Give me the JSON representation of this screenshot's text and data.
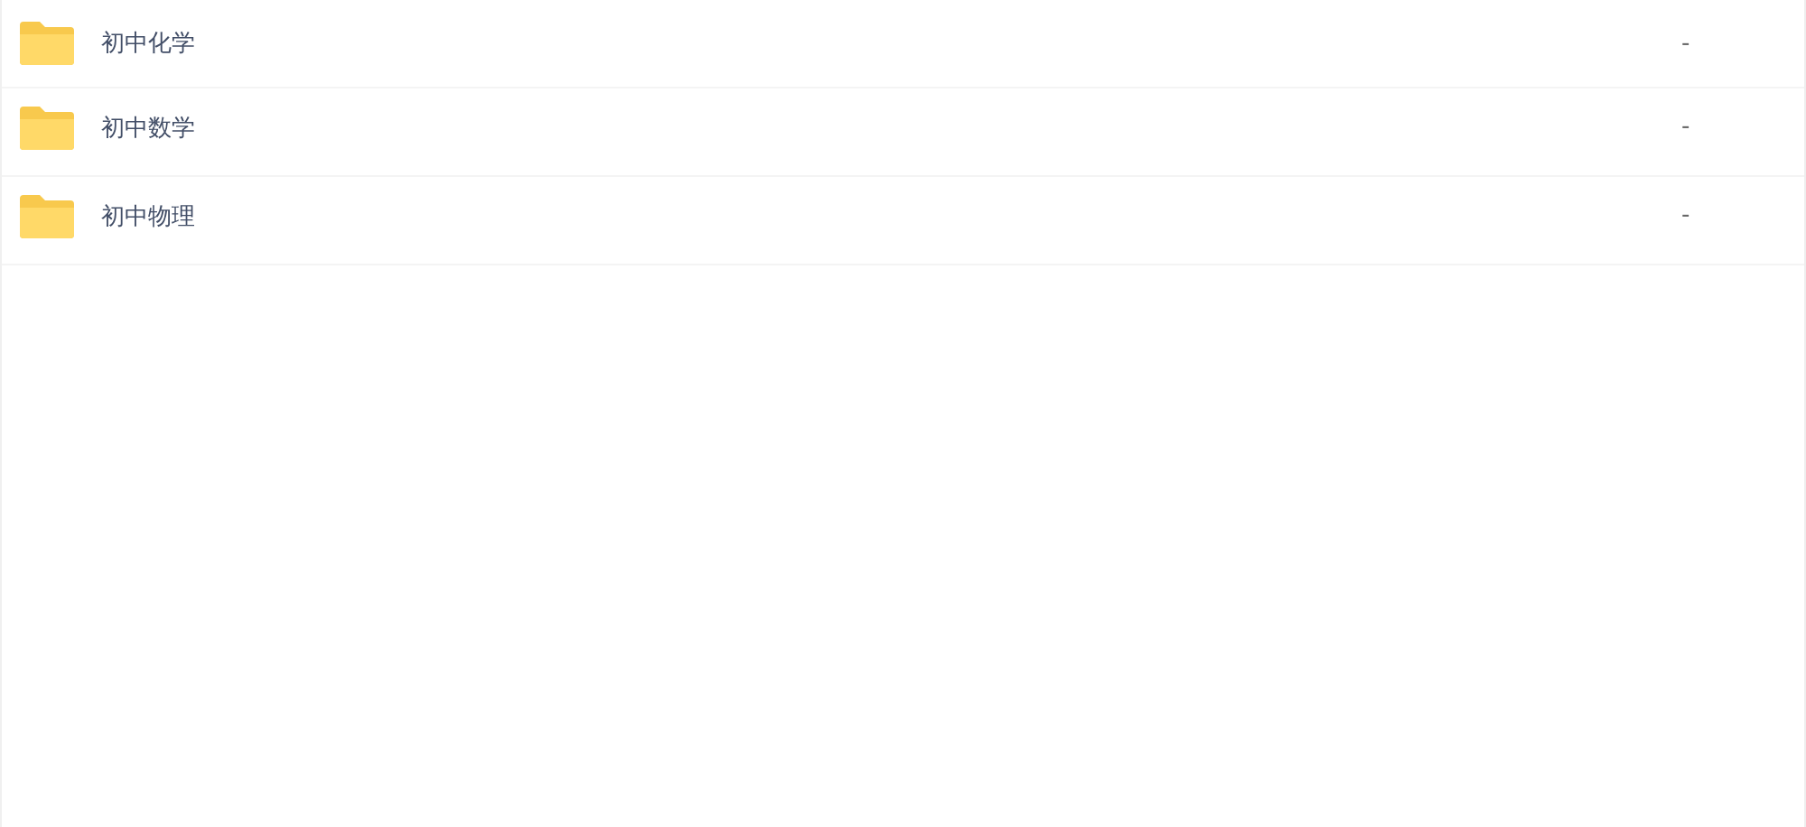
{
  "files": [
    {
      "name": "初中化学",
      "size": "-"
    },
    {
      "name": "初中数学",
      "size": "-"
    },
    {
      "name": "初中物理",
      "size": "-"
    }
  ]
}
